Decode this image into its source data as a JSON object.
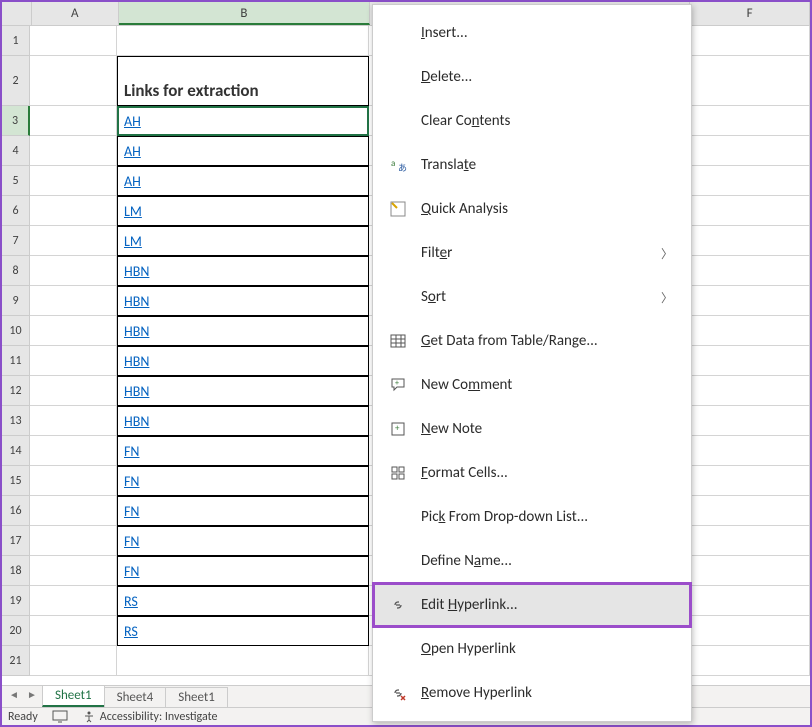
{
  "columns": [
    "A",
    "B",
    "",
    "F"
  ],
  "header_cell": "Links for extraction",
  "rows": [
    {
      "n": 1,
      "val": "",
      "tall": false,
      "header": false
    },
    {
      "n": 2,
      "val": "",
      "tall": true,
      "header": true
    },
    {
      "n": 3,
      "val": "AH",
      "tall": false,
      "header": false
    },
    {
      "n": 4,
      "val": "AH",
      "tall": false,
      "header": false
    },
    {
      "n": 5,
      "val": "AH",
      "tall": false,
      "header": false
    },
    {
      "n": 6,
      "val": "LM",
      "tall": false,
      "header": false
    },
    {
      "n": 7,
      "val": "LM",
      "tall": false,
      "header": false
    },
    {
      "n": 8,
      "val": "HBN",
      "tall": false,
      "header": false
    },
    {
      "n": 9,
      "val": "HBN",
      "tall": false,
      "header": false
    },
    {
      "n": 10,
      "val": "HBN",
      "tall": false,
      "header": false
    },
    {
      "n": 11,
      "val": "HBN",
      "tall": false,
      "header": false
    },
    {
      "n": 12,
      "val": "HBN",
      "tall": false,
      "header": false
    },
    {
      "n": 13,
      "val": "HBN",
      "tall": false,
      "header": false
    },
    {
      "n": 14,
      "val": "FN",
      "tall": false,
      "header": false
    },
    {
      "n": 15,
      "val": "FN",
      "tall": false,
      "header": false
    },
    {
      "n": 16,
      "val": "FN",
      "tall": false,
      "header": false
    },
    {
      "n": 17,
      "val": "FN",
      "tall": false,
      "header": false
    },
    {
      "n": 18,
      "val": "FN",
      "tall": false,
      "header": false
    },
    {
      "n": 19,
      "val": "RS",
      "tall": false,
      "header": false
    },
    {
      "n": 20,
      "val": "RS",
      "tall": false,
      "header": false
    },
    {
      "n": 21,
      "val": "",
      "tall": false,
      "header": false
    }
  ],
  "selected_row": 3,
  "menu": {
    "insert": {
      "pre": "",
      "u": "I",
      "post": "nsert..."
    },
    "delete": {
      "pre": "",
      "u": "D",
      "post": "elete..."
    },
    "clear": {
      "pre": "Clear Co",
      "u": "n",
      "post": "tents"
    },
    "translate": {
      "pre": "Transla",
      "u": "t",
      "post": "e"
    },
    "quick": {
      "pre": "",
      "u": "Q",
      "post": "uick Analysis"
    },
    "filter": {
      "pre": "Filt",
      "u": "e",
      "post": "r"
    },
    "sort": {
      "pre": "S",
      "u": "o",
      "post": "rt"
    },
    "getdata": {
      "pre": "",
      "u": "G",
      "post": "et Data from Table/Range..."
    },
    "comment": {
      "pre": "New Co",
      "u": "m",
      "post": "ment"
    },
    "note": {
      "pre": "",
      "u": "N",
      "post": "ew Note"
    },
    "format": {
      "pre": "",
      "u": "F",
      "post": "ormat Cells..."
    },
    "pick": {
      "pre": "Pic",
      "u": "k",
      "post": " From Drop-down List..."
    },
    "define": {
      "pre": "Define N",
      "u": "a",
      "post": "me..."
    },
    "edith": {
      "pre": "Edit ",
      "u": "H",
      "post": "yperlink..."
    },
    "openh": {
      "pre": "",
      "u": "O",
      "post": "pen Hyperlink"
    },
    "removeh": {
      "pre": "",
      "u": "R",
      "post": "emove Hyperlink"
    }
  },
  "tabs": [
    "Sheet1",
    "Sheet4",
    "Sheet1"
  ],
  "active_tab": 0,
  "status": {
    "ready": "Ready",
    "accessibility": "Accessibility: Investigate"
  }
}
